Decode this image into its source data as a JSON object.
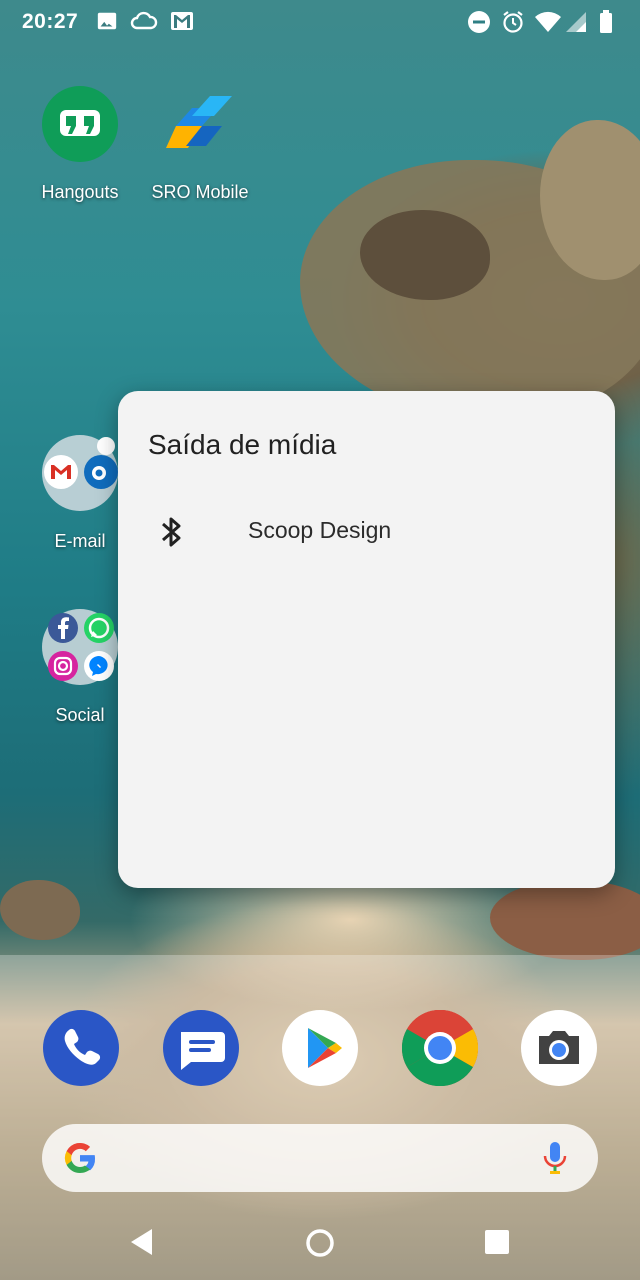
{
  "status_bar": {
    "time": "20:27",
    "left_icons": [
      "image-icon",
      "cloud-icon",
      "gmail-icon"
    ],
    "right_icons": [
      "do-not-disturb-icon",
      "alarm-icon",
      "wifi-icon",
      "cell-signal-icon",
      "battery-icon"
    ]
  },
  "home": {
    "apps": [
      {
        "label": "Hangouts",
        "icon": "hangouts-icon",
        "color": "#0f9d58"
      },
      {
        "label": "SRO Mobile",
        "icon": "sro-mobile-icon",
        "color": "#2196f3"
      }
    ],
    "folders": [
      {
        "label": "E-mail",
        "apps": [
          "gmail-icon",
          "outlook-icon"
        ]
      },
      {
        "label": "Social",
        "apps": [
          "facebook-icon",
          "whatsapp-icon",
          "instagram-icon",
          "messenger-icon"
        ]
      }
    ]
  },
  "dialog": {
    "title": "Saída de mídia",
    "devices": [
      {
        "name": "Scoop Design",
        "icon": "bluetooth-icon"
      }
    ]
  },
  "dock": {
    "apps": [
      {
        "name": "phone",
        "icon": "phone-icon",
        "color": "#2a56c6"
      },
      {
        "name": "messages",
        "icon": "messages-icon",
        "color": "#2a56c6"
      },
      {
        "name": "play-store",
        "icon": "play-store-icon",
        "color": "#ffffff"
      },
      {
        "name": "chrome",
        "icon": "chrome-icon",
        "color": "#db4437"
      },
      {
        "name": "camera",
        "icon": "camera-icon",
        "color": "#ffffff"
      }
    ]
  },
  "search": {
    "placeholder": "",
    "icon": "google-g-icon",
    "mic_icon": "mic-icon"
  },
  "nav": {
    "buttons": [
      "back-icon",
      "home-icon",
      "recents-icon"
    ]
  }
}
